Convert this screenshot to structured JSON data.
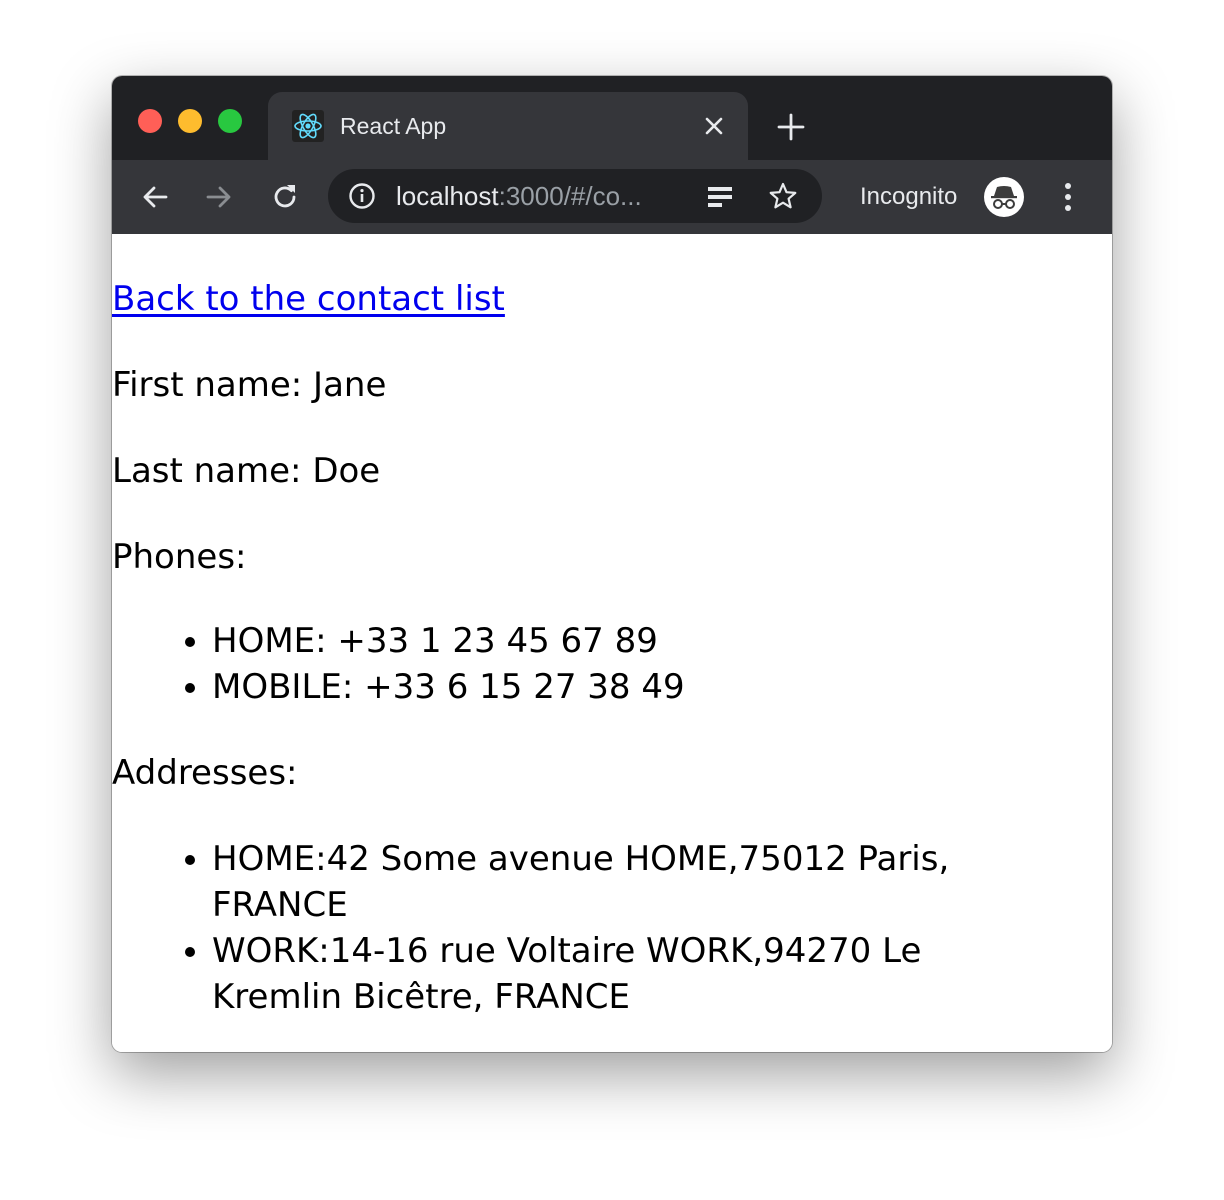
{
  "browser": {
    "tab_title": "React App",
    "url_host": "localhost",
    "url_rest": ":3000/#/co...",
    "incognito_label": "Incognito",
    "icons": {
      "favicon": "react-logo-icon",
      "tab_close": "close-icon",
      "new_tab": "plus-icon",
      "back": "arrow-left-icon",
      "forward": "arrow-right-icon",
      "reload": "reload-icon",
      "site_info": "info-icon",
      "reader": "reader-mode-icon",
      "bookmark": "star-icon",
      "incognito": "incognito-icon",
      "menu": "kebab-menu-icon"
    },
    "colors": {
      "titlebar": "#202124",
      "toolbar": "#35363a",
      "react_accent": "#61dafb"
    }
  },
  "page": {
    "back_link": "Back to the contact list",
    "first_name": "First name: Jane",
    "last_name": "Last name: Doe",
    "phones_heading": "Phones:",
    "phones": [
      "HOME: +33 1 23 45 67 89",
      "MOBILE: +33 6 15 27 38 49"
    ],
    "addresses_heading": "Addresses:",
    "addresses": [
      "HOME:42 Some avenue HOME,75012 Paris, FRANCE",
      "WORK:14-16 rue Voltaire WORK,94270 Le Kremlin Bicêtre, FRANCE"
    ],
    "link_color": "#0000ee"
  }
}
